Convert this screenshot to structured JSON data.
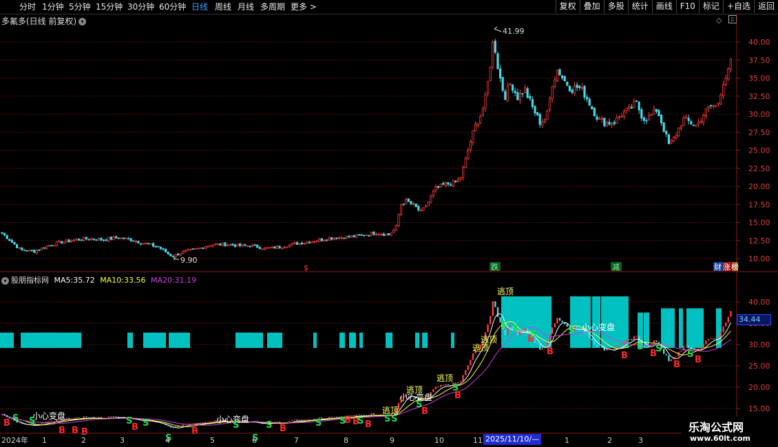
{
  "toolbar": {
    "timeframes": [
      "分时",
      "1分钟",
      "5分钟",
      "15分钟",
      "30分钟",
      "60分钟",
      "日线",
      "周线",
      "月线",
      "多周期",
      "更多"
    ],
    "active_timeframe": "日线",
    "tools": [
      "复权",
      "叠加",
      "多股",
      "统计",
      "画线",
      "F10",
      "标记",
      "+自选",
      "返回"
    ]
  },
  "main_chart": {
    "title": "多氟多(日线 前复权)",
    "high_label": "41.99",
    "low_label": "9.90",
    "y_ticks": [
      "40.00",
      "37.50",
      "35.00",
      "32.50",
      "30.00",
      "27.50",
      "25.00",
      "22.50",
      "20.00",
      "17.50",
      "15.00",
      "12.50",
      "10.00"
    ],
    "event_marks": [
      "$",
      "跌",
      "减",
      "财",
      "涨",
      "榜"
    ]
  },
  "indicator": {
    "name": "股朋指标网",
    "ma5_label": "MA5:",
    "ma5": "35.72",
    "ma10_label": "MA10:",
    "ma10": "33.56",
    "ma20_label": "MA20:",
    "ma20": "31.19",
    "y_ticks": [
      "40.00",
      "35.00",
      "30.00",
      "25.00",
      "20.00",
      "15.00"
    ],
    "current_price": "34.44",
    "annotations": {
      "escape_top": "逃顶",
      "heart_change": "小心变盘",
      "buy": "B",
      "sell": "S"
    }
  },
  "x_axis": {
    "labels": [
      "2024年",
      "1",
      "2",
      "3",
      "4",
      "5",
      "6",
      "7",
      "8",
      "9",
      "10",
      "11",
      "1",
      "2",
      "3"
    ],
    "cursor_date": "2025/11/10/—"
  },
  "watermark": {
    "line1": "乐淘公式网",
    "line2": "www.60lt.com"
  },
  "colors": {
    "up": "#ff3b3b",
    "down": "#48d8e6",
    "ma5": "#ffffff",
    "ma10": "#ffff3c",
    "ma20": "#d040e0",
    "cyan_bar": "#00c0c0",
    "grid": "#8a1a1a"
  },
  "chart_data": {
    "type": "candlestick",
    "series_name": "多氟多",
    "period": "daily",
    "x_range": [
      "2024年",
      "3"
    ],
    "y_range": [
      9.9,
      41.99
    ],
    "ylim": [
      9,
      42
    ],
    "trajectory": [
      [
        0,
        13.8
      ],
      [
        15,
        12.5
      ],
      [
        30,
        11.2
      ],
      [
        50,
        11.0
      ],
      [
        70,
        11.8
      ],
      [
        90,
        12.3
      ],
      [
        110,
        12.6
      ],
      [
        130,
        12.8
      ],
      [
        150,
        12.6
      ],
      [
        170,
        12.9
      ],
      [
        190,
        12.6
      ],
      [
        210,
        12.1
      ],
      [
        230,
        11.6
      ],
      [
        250,
        10.3
      ],
      [
        265,
        10.9
      ],
      [
        285,
        11.3
      ],
      [
        305,
        11.9
      ],
      [
        325,
        12.0
      ],
      [
        345,
        11.8
      ],
      [
        365,
        11.8
      ],
      [
        385,
        11.4
      ],
      [
        405,
        11.6
      ],
      [
        425,
        12.0
      ],
      [
        445,
        12.3
      ],
      [
        465,
        12.6
      ],
      [
        485,
        12.9
      ],
      [
        505,
        13.0
      ],
      [
        525,
        13.2
      ],
      [
        545,
        13.6
      ],
      [
        565,
        13.3
      ],
      [
        575,
        14.2
      ],
      [
        582,
        17.5
      ],
      [
        590,
        18.0
      ],
      [
        600,
        17.4
      ],
      [
        612,
        16.4
      ],
      [
        622,
        17.8
      ],
      [
        632,
        19.6
      ],
      [
        645,
        20.2
      ],
      [
        658,
        20.5
      ],
      [
        668,
        21.0
      ],
      [
        676,
        23.5
      ],
      [
        684,
        26.5
      ],
      [
        692,
        28.8
      ],
      [
        700,
        30.2
      ],
      [
        706,
        32.5
      ],
      [
        712,
        36.8
      ],
      [
        717,
        40.6
      ],
      [
        724,
        36.0
      ],
      [
        733,
        32.4
      ],
      [
        742,
        34.4
      ],
      [
        752,
        32.3
      ],
      [
        762,
        33.5
      ],
      [
        772,
        31.2
      ],
      [
        784,
        28.9
      ],
      [
        794,
        29.4
      ],
      [
        802,
        34.3
      ],
      [
        810,
        36.2
      ],
      [
        820,
        34.6
      ],
      [
        830,
        33.5
      ],
      [
        840,
        33.8
      ],
      [
        850,
        32.7
      ],
      [
        860,
        30.8
      ],
      [
        870,
        29.2
      ],
      [
        880,
        28.8
      ],
      [
        892,
        28.9
      ],
      [
        904,
        30.1
      ],
      [
        914,
        30.6
      ],
      [
        924,
        31.6
      ],
      [
        934,
        29.4
      ],
      [
        944,
        29.6
      ],
      [
        954,
        30.7
      ],
      [
        962,
        28.6
      ],
      [
        972,
        25.6
      ],
      [
        982,
        27.2
      ],
      [
        992,
        29.3
      ],
      [
        1002,
        28.9
      ],
      [
        1012,
        28.4
      ],
      [
        1022,
        30.0
      ],
      [
        1032,
        31.2
      ],
      [
        1042,
        31.1
      ],
      [
        1050,
        34.4
      ],
      [
        1058,
        35.8
      ],
      [
        1062,
        37.6
      ]
    ]
  }
}
